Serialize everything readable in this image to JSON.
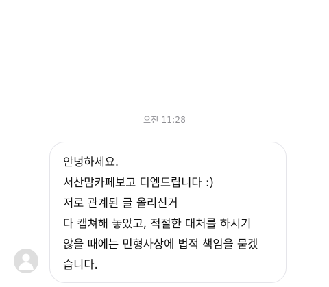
{
  "conversation": {
    "timestamp": "오전 11:28",
    "message": {
      "lines": [
        "안녕하세요.",
        "서산맘카페보고 디엠드립니다 :)",
        "저로 관계된 글 올리신거",
        "다 캡쳐해 놓았고, 적절한 대처를 하시기",
        "않을 때에는 민형사상에 법적 책임을 묻겠",
        "습니다."
      ]
    },
    "sender": {
      "avatar_icon": "default-profile-avatar-icon"
    }
  }
}
